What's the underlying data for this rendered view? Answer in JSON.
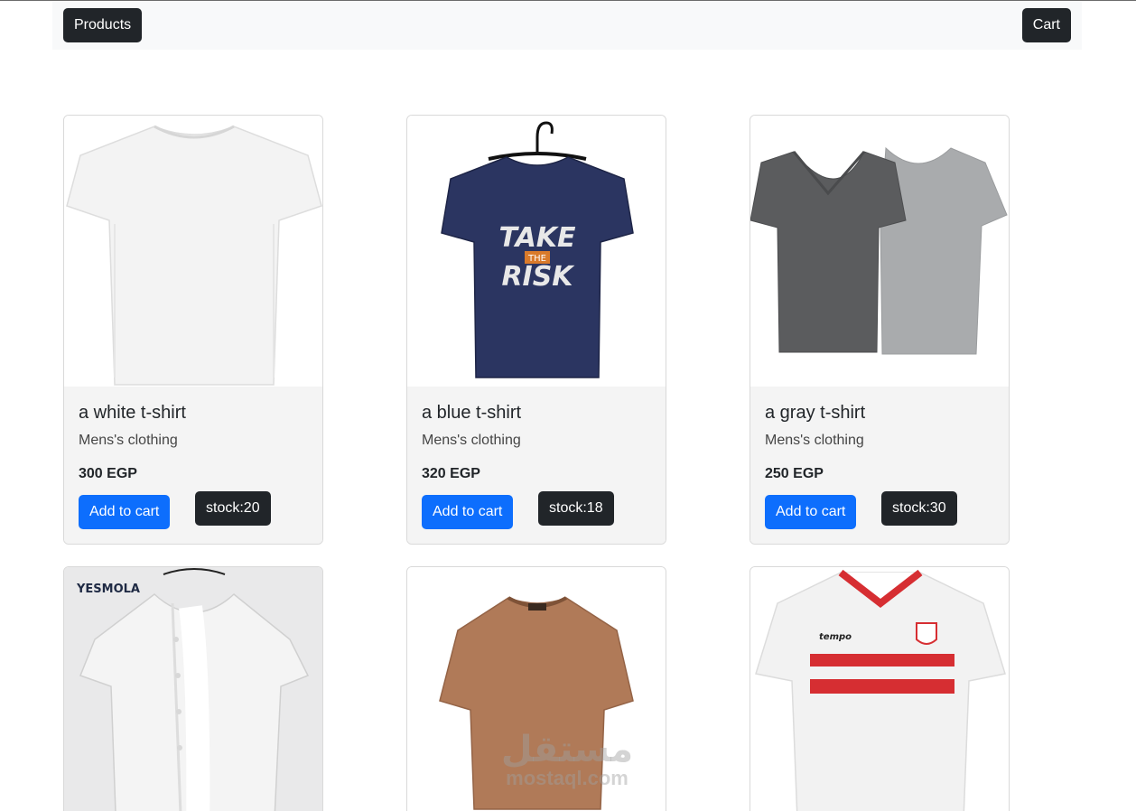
{
  "navbar": {
    "products_label": "Products",
    "cart_label": "Cart"
  },
  "products": [
    {
      "title": "a white t-shirt",
      "category": "Mens's clothing",
      "price": "300 EGP",
      "add_label": "Add to cart",
      "stock": "stock:20",
      "image_icon": "white-tshirt"
    },
    {
      "title": "a blue t-shirt",
      "category": "Mens's clothing",
      "price": "320 EGP",
      "add_label": "Add to cart",
      "stock": "stock:18",
      "image_icon": "navy-tshirt-take-the-risk",
      "print_text": [
        "TAKE",
        "THE",
        "RISK"
      ]
    },
    {
      "title": "a gray t-shirt",
      "category": "Mens's clothing",
      "price": "250 EGP",
      "add_label": "Add to cart",
      "stock": "stock:30",
      "image_icon": "gray-tshirts"
    },
    {
      "image_icon": "linen-shirt",
      "brand_text": "YESMOLA"
    },
    {
      "image_icon": "brown-tshirt"
    },
    {
      "image_icon": "football-jersey",
      "brand_text": "tempo"
    }
  ],
  "watermark": {
    "arabic": "مستقل",
    "latin": "mostaql.com"
  },
  "colors": {
    "navbar_bg": "#f8f9fa",
    "dark_button": "#212529",
    "primary_button": "#0d6efd",
    "card_body_bg": "#f4f4f4"
  }
}
